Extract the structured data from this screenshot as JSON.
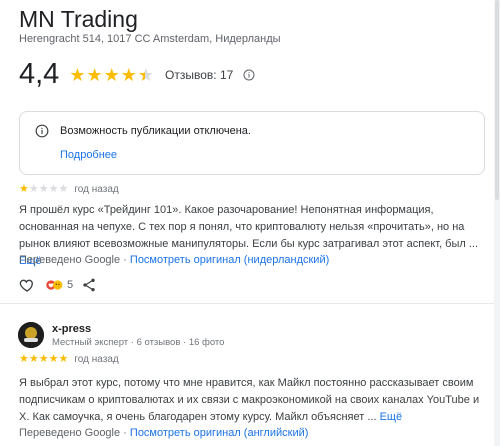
{
  "place": {
    "title": "MN Trading",
    "address": "Herengracht 514, 1017 CC Amsterdam, Нидерланды",
    "rating": "4,4",
    "reviews_label": "Отзывов: 17"
  },
  "notice": {
    "text": "Возможность публикации отключена.",
    "more_link": "Подробнее"
  },
  "reviews": [
    {
      "stars": 1,
      "time": "год назад",
      "text": "Я прошёл курс «Трейдинг 101». Какое разочарование! Непонятная информация, основанная на чепухе. С тех пор я понял, что криптовалюту нельзя «прочитать», но на рынок влияют всевозможные манипуляторы. Если бы курс затрагивал этот аспект, был ...",
      "more": "Ещё",
      "translated_prefix": "Переведено Google ·",
      "original_link": "Посмотреть оригинал (нидерландский)",
      "reactions": "5"
    },
    {
      "author": "x-press",
      "meta": "Местный эксперт · 6 отзывов · 16 фото",
      "stars": 5,
      "time": "год назад",
      "text": "Я выбрал этот курс, потому что мне нравится, как Майкл постоянно рассказывает своим подписчикам о криптовалютах и их связи с макроэкономикой на своих каналах YouTube и X. Как самоучка, я очень благодарен этому курсу. Майкл объясняет ...",
      "more": "Ещё",
      "translated_prefix": "Переведено Google ·",
      "original_link": "Посмотреть оригинал (английский)"
    }
  ],
  "colors": {
    "star": "#fbbc04",
    "link": "#1a73e8",
    "muted": "#5f6368"
  },
  "icons": [
    "info-icon",
    "heart-icon",
    "share-icon",
    "reaction-icon"
  ]
}
